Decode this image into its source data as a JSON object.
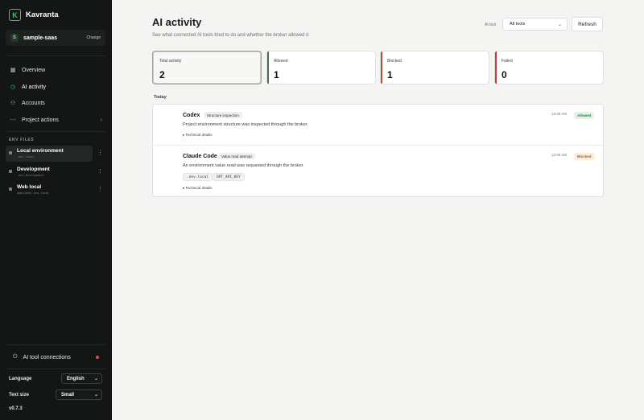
{
  "app": {
    "name": "Kavranta",
    "logo_letter": "K"
  },
  "project": {
    "avatar": "S",
    "name": "sample-saas",
    "change_label": "Change"
  },
  "nav": [
    {
      "label": "Overview",
      "icon": "grid-icon"
    },
    {
      "label": "AI activity",
      "icon": "clock-icon",
      "active": true
    },
    {
      "label": "Accounts",
      "icon": "users-icon"
    },
    {
      "label": "Project actions",
      "icon": "dots-icon"
    }
  ],
  "env_section": {
    "label": "ENV FILES",
    "items": [
      {
        "name": "Local environment",
        "file": ".env.local",
        "active": true
      },
      {
        "name": "Development",
        "file": ".env.development"
      },
      {
        "name": "Web local",
        "file": "apps/web/.env.local"
      }
    ]
  },
  "connections": {
    "label": "AI tool connections",
    "alert_color": "#e04a4a"
  },
  "settings": {
    "language_label": "Language",
    "language_value": "English",
    "text_size_label": "Text size",
    "text_size_value": "Small"
  },
  "version": "v0.7.3",
  "page": {
    "title": "AI activity",
    "subtitle": "See what connected AI tools tried to do and whether the broker allowed it.",
    "tool_filter_label": "AI tool",
    "tool_filter_value": "All tools",
    "refresh_label": "Refresh"
  },
  "stats": [
    {
      "label": "Total activity",
      "value": "2",
      "active": true
    },
    {
      "label": "Allowed",
      "value": "1",
      "color": "#4b6a55"
    },
    {
      "label": "Blocked",
      "value": "1",
      "color": "#b3532e"
    },
    {
      "label": "Failed",
      "value": "0",
      "color": "#c33a3a"
    }
  ],
  "group_label": "Today",
  "activity": [
    {
      "tool": "Codex",
      "tag": "Structure inspection",
      "desc": "Project environment structure was inspected through the broker.",
      "details": "▸ Technical details",
      "time": "12:00 AM",
      "status": "Allowed",
      "chips": []
    },
    {
      "tool": "Claude Code",
      "tag": "Value read attempt",
      "desc": "An environment value read was requested through the broker.",
      "details": "▸ Technical details",
      "time": "12:00 AM",
      "status": "Blocked",
      "chips": [
        ".env.local",
        "OPT_API_KEY"
      ]
    }
  ],
  "colors": {
    "accent": "#3fc27a",
    "sidebar_bg": "#131614"
  }
}
